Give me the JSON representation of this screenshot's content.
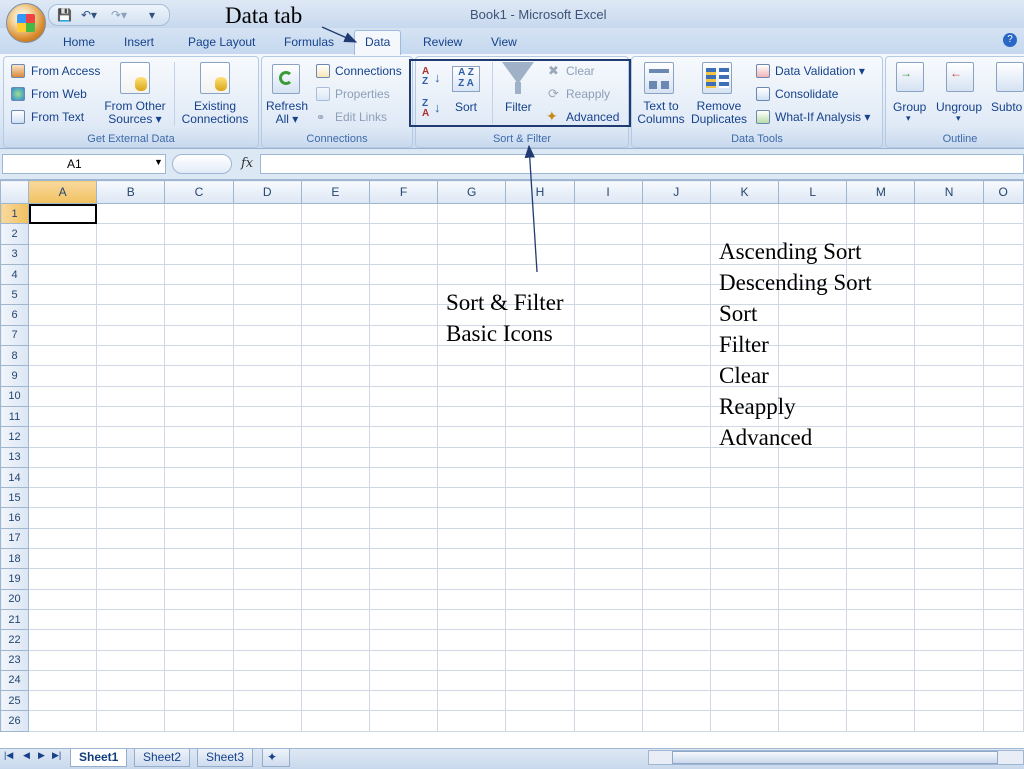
{
  "window": {
    "title": "Book1 - Microsoft Excel"
  },
  "quick_access": {
    "save_icon": "save-icon",
    "undo_icon": "undo-icon",
    "redo_icon": "redo-icon"
  },
  "tabs": [
    "Home",
    "Insert",
    "Page Layout",
    "Formulas",
    "Data",
    "Review",
    "View"
  ],
  "active_tab": "Data",
  "ribbon": {
    "get_external_data": {
      "label": "Get External Data",
      "from_access": "From Access",
      "from_web": "From Web",
      "from_text": "From Text",
      "from_other_sources_1": "From Other",
      "from_other_sources_2": "Sources ▾",
      "existing_connections_1": "Existing",
      "existing_connections_2": "Connections"
    },
    "connections": {
      "label": "Connections",
      "refresh_1": "Refresh",
      "refresh_2": "All ▾",
      "connections": "Connections",
      "properties": "Properties",
      "edit_links": "Edit Links"
    },
    "sort_filter": {
      "label": "Sort & Filter",
      "sort": "Sort",
      "filter": "Filter",
      "clear": "Clear",
      "reapply": "Reapply",
      "advanced": "Advanced"
    },
    "data_tools": {
      "label": "Data Tools",
      "text_to_columns_1": "Text to",
      "text_to_columns_2": "Columns",
      "remove_duplicates_1": "Remove",
      "remove_duplicates_2": "Duplicates",
      "data_validation": "Data Validation ▾",
      "consolidate": "Consolidate",
      "what_if": "What-If Analysis ▾"
    },
    "outline": {
      "label": "Outline",
      "group": "Group",
      "ungroup": "Ungroup",
      "subtotal": "Subto",
      "group_drop": "▾",
      "ungroup_drop": "▾"
    }
  },
  "formula_bar": {
    "name_box": "A1",
    "fx": "fx",
    "value": ""
  },
  "grid": {
    "columns": [
      "A",
      "B",
      "C",
      "D",
      "E",
      "F",
      "G",
      "H",
      "I",
      "J",
      "K",
      "L",
      "M",
      "N",
      "O"
    ],
    "rows": [
      "1",
      "2",
      "3",
      "4",
      "5",
      "6",
      "7",
      "8",
      "9",
      "10",
      "11",
      "12",
      "13",
      "14",
      "15",
      "16",
      "17",
      "18",
      "19",
      "20",
      "21",
      "22",
      "23",
      "24",
      "25",
      "26"
    ],
    "active_cell": "A1"
  },
  "sheets": [
    "Sheet1",
    "Sheet2",
    "Sheet3"
  ],
  "active_sheet": "Sheet1",
  "annotations": {
    "data_tab": "Data tab",
    "sort_filter_1": "Sort & Filter",
    "sort_filter_2": "Basic Icons",
    "icons_list": [
      "Ascending Sort",
      "Descending Sort",
      "Sort",
      "Filter",
      "Clear",
      "Reapply",
      "Advanced"
    ]
  },
  "colors": {
    "highlight_box": "#1f3b71",
    "selected_header": "#f1c15f",
    "ribbon_text": "#15428b"
  }
}
